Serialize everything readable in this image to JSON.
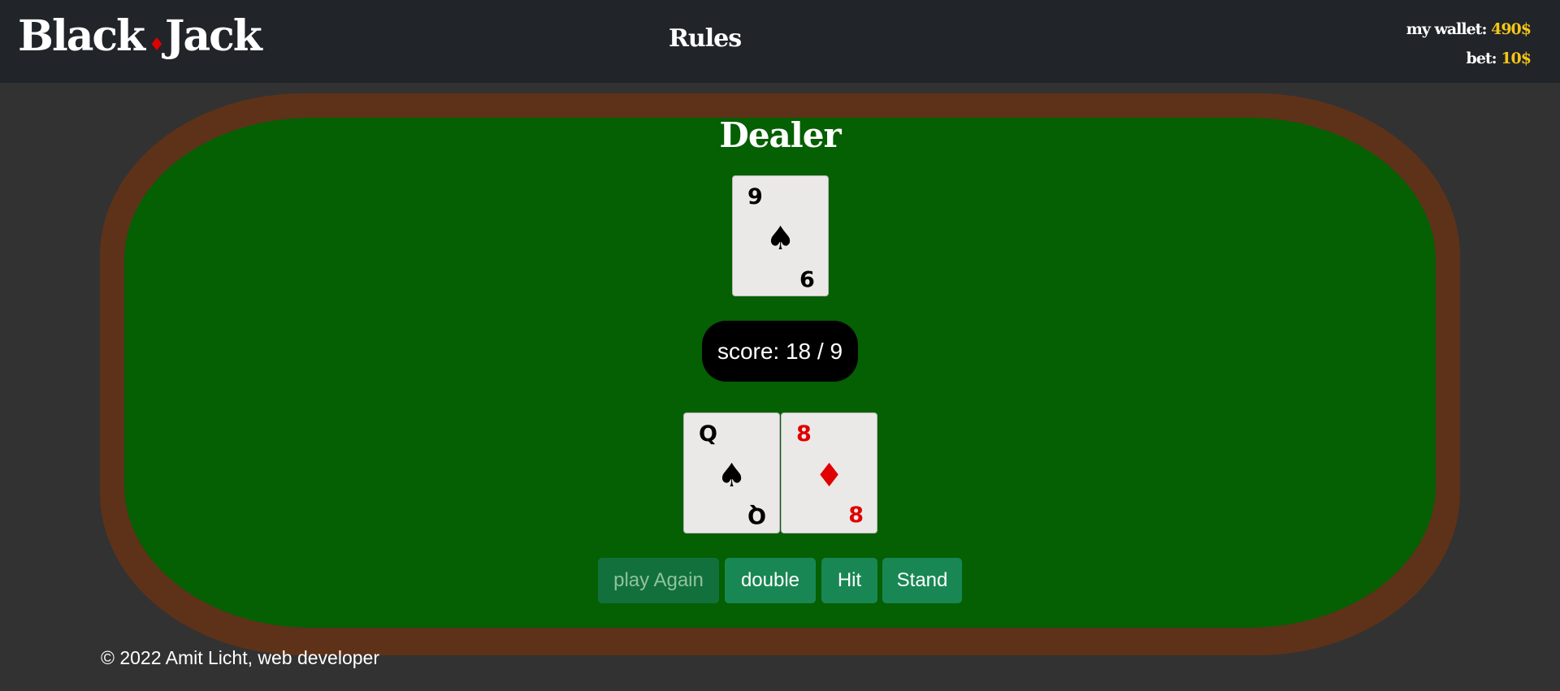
{
  "header": {
    "brand_left": "Black",
    "brand_right": "Jack",
    "brand_symbol": "♦",
    "rules_label": "Rules",
    "wallet_label": "my wallet:",
    "wallet_value": "490$",
    "bet_label": "bet:",
    "bet_value": "10$"
  },
  "dealer": {
    "title": "Dealer",
    "cards": [
      {
        "rank": "9",
        "suit": "♠",
        "suit_name": "spade-icon",
        "color": "black"
      }
    ]
  },
  "score": {
    "text": "score: 18 / 9"
  },
  "player": {
    "cards": [
      {
        "rank": "Q",
        "suit": "♠",
        "suit_name": "spade-icon",
        "color": "black"
      },
      {
        "rank": "8",
        "suit": "♦",
        "suit_name": "diamond-icon",
        "color": "red"
      }
    ]
  },
  "actions": {
    "play_again": "play Again",
    "double": "double",
    "hit": "Hit",
    "stand": "Stand"
  },
  "footer": {
    "text": "© 2022 Amit Licht, web developer"
  },
  "colors": {
    "felt": "#055f03",
    "rim": "#5e3219",
    "button": "#198754",
    "gold": "#f5c518",
    "red_suit": "#e00000"
  }
}
